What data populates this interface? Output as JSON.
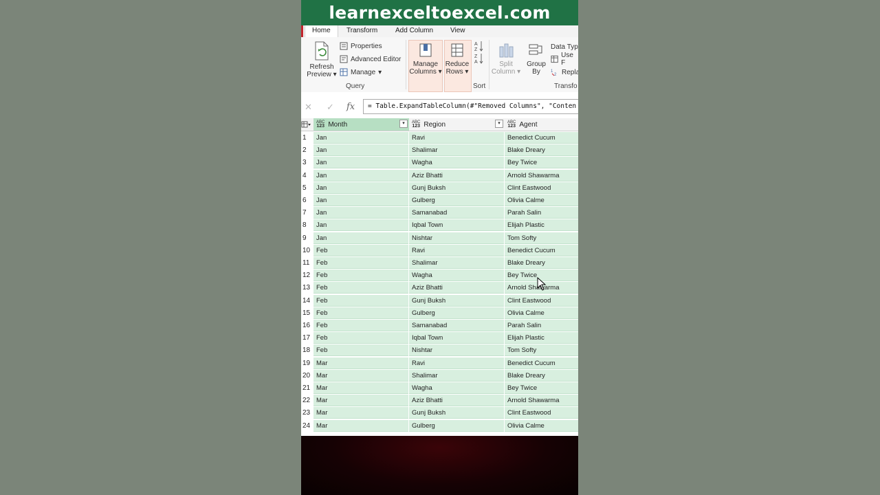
{
  "banner": {
    "text": "learnexceltoexcel.com"
  },
  "tabs": [
    {
      "label": "Home",
      "active": true
    },
    {
      "label": "Transform",
      "active": false
    },
    {
      "label": "Add Column",
      "active": false
    },
    {
      "label": "View",
      "active": false
    }
  ],
  "ribbon": {
    "refresh_label_1": "Refresh",
    "refresh_label_2": "Preview",
    "properties": "Properties",
    "advanced_editor": "Advanced Editor",
    "manage": "Manage",
    "query_group": "Query",
    "manage_columns_1": "Manage",
    "manage_columns_2": "Columns",
    "reduce_rows_1": "Reduce",
    "reduce_rows_2": "Rows",
    "sort_group": "Sort",
    "split_column_1": "Split",
    "split_column_2": "Column",
    "group_by_1": "Group",
    "group_by_2": "By",
    "data_type": "Data Typ",
    "use_first": "Use F",
    "replace": "Repla",
    "transform_group": "Transfo"
  },
  "formula_bar": {
    "formula": "= Table.ExpandTableColumn(#\"Removed Columns\", \"Conten"
  },
  "columns": [
    {
      "name": "Month",
      "type_top": "ABC",
      "type_bottom": "123"
    },
    {
      "name": "Region",
      "type_top": "ABC",
      "type_bottom": "123"
    },
    {
      "name": "Agent",
      "type_top": "ABC",
      "type_bottom": "123"
    }
  ],
  "rows": [
    [
      "1",
      "Jan",
      "Ravi",
      "Benedict Cucum"
    ],
    [
      "2",
      "Jan",
      "Shalimar",
      "Blake Dreary"
    ],
    [
      "3",
      "Jan",
      "Wagha",
      "Bey Twice"
    ],
    [
      "4",
      "Jan",
      "Aziz Bhatti",
      "Arnold Shawarma"
    ],
    [
      "5",
      "Jan",
      "Gunj Buksh",
      "Clint Eastwood"
    ],
    [
      "6",
      "Jan",
      "Gulberg",
      "Olivia Calme"
    ],
    [
      "7",
      "Jan",
      "Samanabad",
      "Parah Salin"
    ],
    [
      "8",
      "Jan",
      "Iqbal Town",
      "Elijah Plastic"
    ],
    [
      "9",
      "Jan",
      "Nishtar",
      "Tom Softy"
    ],
    [
      "10",
      "Feb",
      "Ravi",
      "Benedict Cucum"
    ],
    [
      "11",
      "Feb",
      "Shalimar",
      "Blake Dreary"
    ],
    [
      "12",
      "Feb",
      "Wagha",
      "Bey Twice"
    ],
    [
      "13",
      "Feb",
      "Aziz Bhatti",
      "Arnold Shawarma"
    ],
    [
      "14",
      "Feb",
      "Gunj Buksh",
      "Clint Eastwood"
    ],
    [
      "15",
      "Feb",
      "Gulberg",
      "Olivia Calme"
    ],
    [
      "16",
      "Feb",
      "Samanabad",
      "Parah Salin"
    ],
    [
      "17",
      "Feb",
      "Iqbal Town",
      "Elijah Plastic"
    ],
    [
      "18",
      "Feb",
      "Nishtar",
      "Tom Softy"
    ],
    [
      "19",
      "Mar",
      "Ravi",
      "Benedict Cucum"
    ],
    [
      "20",
      "Mar",
      "Shalimar",
      "Blake Dreary"
    ],
    [
      "21",
      "Mar",
      "Wagha",
      "Bey Twice"
    ],
    [
      "22",
      "Mar",
      "Aziz Bhatti",
      "Arnold Shawarma"
    ],
    [
      "23",
      "Mar",
      "Gunj Buksh",
      "Clint Eastwood"
    ],
    [
      "24",
      "Mar",
      "Gulberg",
      "Olivia Calme"
    ]
  ],
  "colors": {
    "banner": "#207245",
    "selected_header": "#b7dfc3",
    "cell_fill": "#d8efdf"
  }
}
